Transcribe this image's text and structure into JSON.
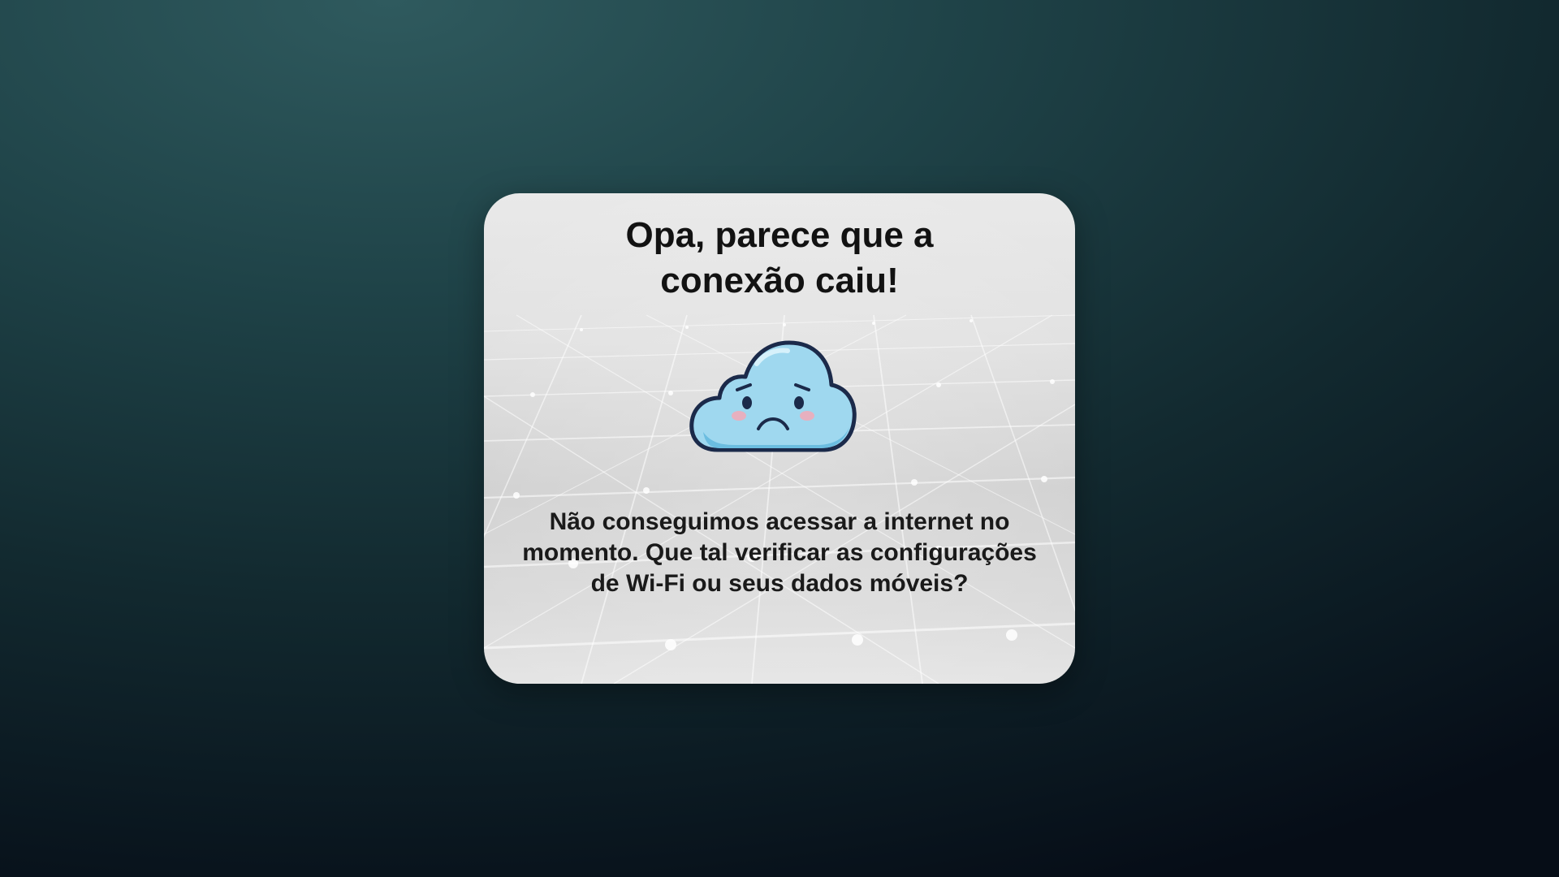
{
  "dialog": {
    "title_lines": [
      "Opa, parece que a",
      "conexão caiu!"
    ],
    "message_lines": [
      "Não conseguimos acessar a internet no",
      "momento. Que tal verificar as configurações",
      "de Wi-Fi ou seus dados móveis?"
    ],
    "illustration": "sad-cloud-icon"
  },
  "colors": {
    "background_top": "#2f5a5e",
    "background_bottom": "#060d17",
    "card": "#dcdcdc",
    "cloud_fill": "#9fd8ef",
    "cloud_outline": "#1b2a4a",
    "text": "#121212"
  }
}
